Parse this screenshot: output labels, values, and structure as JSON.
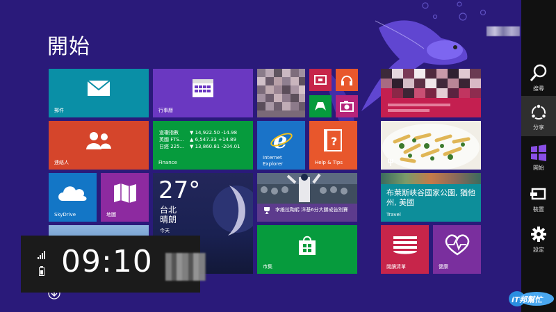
{
  "page": {
    "title": "開始"
  },
  "tiles": {
    "mail": {
      "label": "郵件",
      "color": "#0a8fa6"
    },
    "calendar": {
      "label": "行事曆",
      "color": "#6a38c1"
    },
    "people": {
      "label": "連絡人",
      "color": "#d5452b"
    },
    "finance": {
      "label": "Finance",
      "color": "#069b3d",
      "rows": [
        {
          "name": "道瓊指數",
          "value": "▼ 14,922.50 -14.98"
        },
        {
          "name": "英國 FTS...",
          "value": "▲ 6,547.33 +14.89"
        },
        {
          "name": "日經 225...",
          "value": "▼ 13,860.81 -204.01"
        }
      ]
    },
    "ie": {
      "label": "Internet Explorer",
      "color": "#1a73c8"
    },
    "help": {
      "label": "Help & Tips",
      "color": "#e8572c"
    },
    "skydrive": {
      "label": "SkyDrive",
      "color": "#1376c6"
    },
    "maps": {
      "label": "地圖",
      "color": "#8d2aa0"
    },
    "weather": {
      "temp": "27°",
      "city": "台北",
      "condition": "晴朗",
      "today": "今天"
    },
    "sports": {
      "headline": "李維拉鞠躬 洋基6分大勝成告別賽"
    },
    "store": {
      "label": "市集",
      "color": "#069b3d"
    },
    "food": {
      "label": ""
    },
    "travel": {
      "label": "Travel",
      "text": "布萊斯峽谷國家公園, 猶他州, 美國",
      "color": "#0d8e9a"
    },
    "reading_list": {
      "label": "閱讀清單",
      "color": "#c7254a"
    },
    "health": {
      "label": "健康",
      "color": "#7a2f9e"
    },
    "video": {
      "color": "#c7254a"
    },
    "music": {
      "color": "#e8572c"
    },
    "games": {
      "color": "#069b3d"
    },
    "camera": {
      "color": "#b6247a"
    }
  },
  "charms": [
    {
      "label": "搜尋",
      "icon": "search-icon"
    },
    {
      "label": "分享",
      "icon": "share-icon"
    },
    {
      "label": "開始",
      "icon": "windows-icon"
    },
    {
      "label": "裝置",
      "icon": "devices-icon"
    },
    {
      "label": "設定",
      "icon": "settings-icon"
    }
  ],
  "clock": {
    "time": "09:10"
  },
  "watermark": {
    "text": "iT邦幫忙"
  }
}
